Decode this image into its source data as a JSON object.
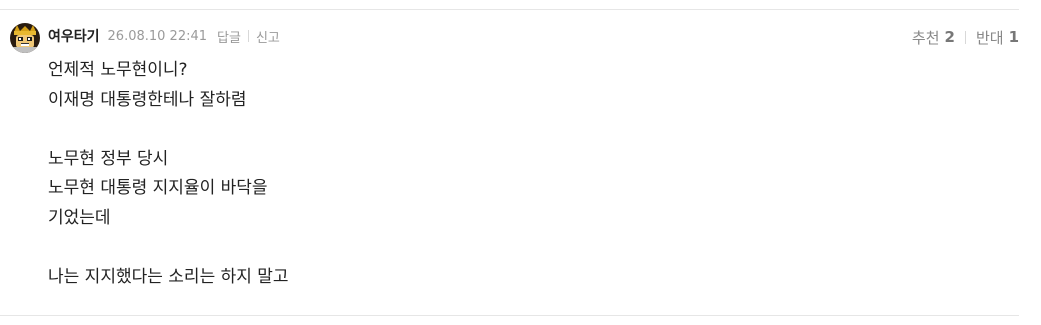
{
  "comment": {
    "author": "여우타기",
    "timestamp": "26.08.10 22:41",
    "reply_label": "답글",
    "report_label": "신고",
    "upvote_label": "추천",
    "upvote_count": "2",
    "downvote_label": "반대",
    "downvote_count": "1",
    "avatar_icon": "fox-avatar-icon",
    "lines": [
      "언제적 노무현이니?",
      "이재명 대통령한테나 잘하렴",
      "",
      "노무현 정부 당시",
      "노무현 대통령 지지율이 바닥을",
      "기었는데",
      "",
      "나는 지지했다는 소리는 하지 말고"
    ]
  },
  "colors": {
    "text": "#222222",
    "meta": "#9a9a9a",
    "divider": "#e6e6e6"
  }
}
